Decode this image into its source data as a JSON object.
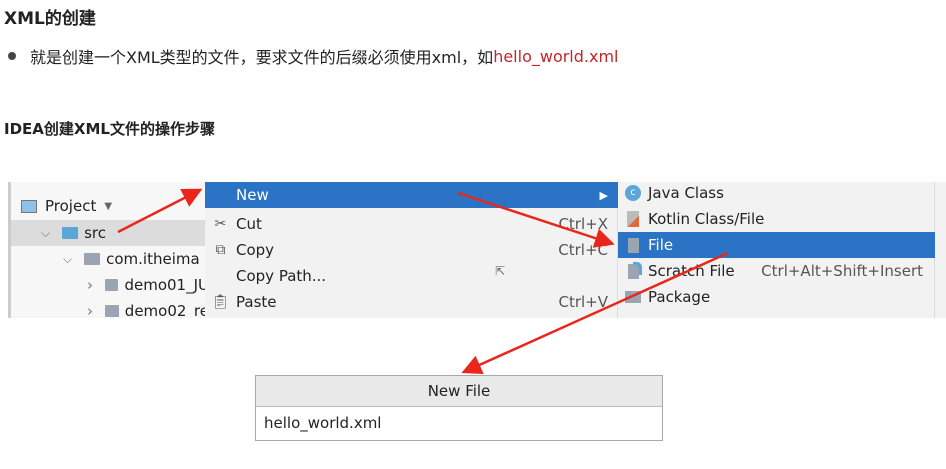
{
  "title": "XML的创建",
  "bullet": {
    "text": "就是创建一个XML类型的文件，要求文件的后缀必须使用xml，如",
    "example": "hello_world.xml"
  },
  "subtitle": "IDEA创建XML文件的操作步骤",
  "tree": {
    "header": "Project",
    "items": [
      {
        "label": "src",
        "icon": "folder-icon"
      },
      {
        "label": "com.itheima",
        "icon": "package-icon"
      },
      {
        "label": "demo01_JU",
        "icon": "package-icon"
      },
      {
        "label": "demo02_re",
        "icon": "package-icon"
      }
    ]
  },
  "context_menu": {
    "items": [
      {
        "label": "New",
        "shortcut": ""
      },
      {
        "label": "Cut",
        "shortcut": "Ctrl+X",
        "icon": "scissors-icon"
      },
      {
        "label": "Copy",
        "shortcut": "Ctrl+C",
        "icon": "copy-icon"
      },
      {
        "label": "Copy Path...",
        "shortcut": ""
      },
      {
        "label": "Paste",
        "shortcut": "Ctrl+V",
        "icon": "clipboard-icon"
      }
    ]
  },
  "submenu": {
    "items": [
      {
        "label": "Java Class",
        "shortcut": "",
        "icon": "java-class-icon"
      },
      {
        "label": "Kotlin Class/File",
        "shortcut": "",
        "icon": "kotlin-file-icon"
      },
      {
        "label": "File",
        "shortcut": "",
        "icon": "file-icon"
      },
      {
        "label": "Scratch File",
        "shortcut": "Ctrl+Alt+Shift+Insert",
        "icon": "scratch-file-icon"
      },
      {
        "label": "Package",
        "shortcut": "",
        "icon": "package-icon"
      }
    ]
  },
  "dialog": {
    "title": "New File",
    "value": "hello_world.xml"
  },
  "colors": {
    "selection": "#2b73c5",
    "arrow": "#e8261c",
    "highlight": "#c0262a"
  }
}
